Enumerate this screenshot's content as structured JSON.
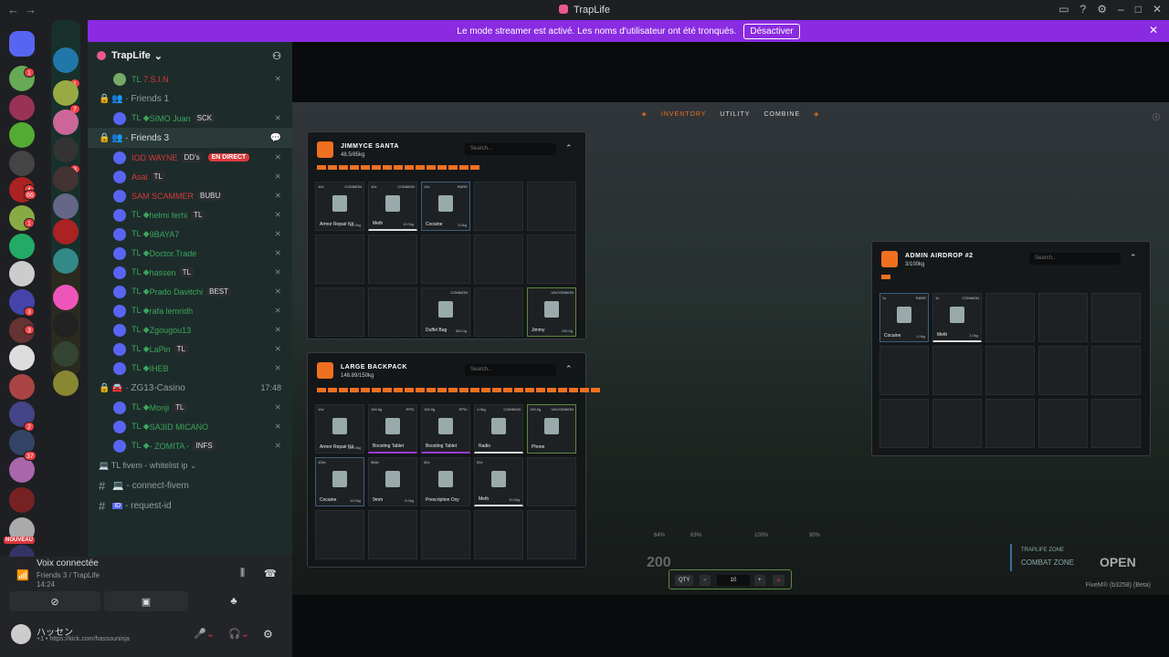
{
  "titlebar": {
    "nav": "←→",
    "title": "TrapLife"
  },
  "banner": {
    "text": "Le mode streamer est activé. Les noms d'utilisateur ont été tronqués.",
    "button": "Désactiver",
    "close": "✕"
  },
  "server_badges": [
    "1",
    "4",
    "66",
    "1",
    "3",
    "3",
    "2",
    "37",
    "1",
    "3",
    "7"
  ],
  "new_label": "NOUVEAU",
  "server": {
    "name": "TrapLife",
    "chevron": "⌄"
  },
  "voice_channels": [
    {
      "name": "Friends 1"
    },
    {
      "name": "Friends 3",
      "active": true
    },
    {
      "name": "ZG13-Casino",
      "time": "17:48"
    }
  ],
  "top_user": {
    "prefix": "TL",
    "name": "7.S.I.N"
  },
  "friends1_users": [
    {
      "prefix": "TL",
      "name": "SIMO Juan",
      "tag": "SCK"
    }
  ],
  "friends3_users": [
    {
      "prefix": "",
      "name": "IOD WAYNE",
      "tag": "DD's",
      "live": "EN DIRECT"
    },
    {
      "prefix": "",
      "name": "Asal",
      "tag": "TL"
    },
    {
      "prefix": "",
      "name": "SAM SCAMMER",
      "tag": "BUBU"
    },
    {
      "prefix": "TL",
      "name": "helmi ferhi",
      "tag": "TL"
    },
    {
      "prefix": "TL",
      "name": "9BAYA7",
      "tag": ""
    },
    {
      "prefix": "TL",
      "name": "Doctor.Trade",
      "tag": ""
    },
    {
      "prefix": "TL",
      "name": "hassen",
      "tag": "TL"
    },
    {
      "prefix": "TL",
      "name": "Prado Davitchi",
      "tag": "BEST"
    },
    {
      "prefix": "TL",
      "name": "rafa lemridh",
      "tag": ""
    },
    {
      "prefix": "TL",
      "name": "Zgougou13",
      "tag": ""
    },
    {
      "prefix": "TL",
      "name": "LaPin",
      "tag": "TL"
    },
    {
      "prefix": "TL",
      "name": "IHEB",
      "tag": ""
    }
  ],
  "casino_users": [
    {
      "prefix": "TL",
      "name": "Monji",
      "tag": "TL"
    },
    {
      "prefix": "TL",
      "name": "SA3ID MICANO",
      "tag": ""
    },
    {
      "prefix": "TL",
      "name": "- ZOMITA -",
      "tag": "INFS"
    }
  ],
  "category": "TL fivem - whitelist ip",
  "text_channels": [
    {
      "name": "connect-fivem"
    },
    {
      "name": "request-id"
    }
  ],
  "voice": {
    "title": "Voix connectée",
    "sub": "Friends 3 / TrapLife",
    "time": "14:24"
  },
  "user": {
    "name": "ハッセン",
    "status": "+1 • https://kick.com/hassouninja"
  },
  "game": {
    "nav": [
      "INVENTORY",
      "UTILITY",
      "COMBINE"
    ],
    "panel1": {
      "title": "JIMMYCE SANTA",
      "weight": "48.5/85kg",
      "search": "Search...",
      "bars": 15,
      "slots": [
        {
          "q": "10x",
          "r": "COMMON",
          "n": "Armor Repair Kit",
          "w": "22.0kg",
          "c": ""
        },
        {
          "q": "10x",
          "r": "COMMON",
          "n": "Meth",
          "w": "10.0kg",
          "c": "white"
        },
        {
          "q": "12x",
          "r": "RARE",
          "n": "Cocaine",
          "w": "3.0kg",
          "c": "blue"
        },
        {},
        {},
        {},
        {},
        {},
        {},
        {},
        {},
        {},
        {
          "q": "",
          "r": "COMMON",
          "n": "Duffel Bag",
          "w": "500.0g",
          "c": ""
        },
        {},
        {
          "q": "",
          "r": "UNCOMMON",
          "n": "Jimmy",
          "w": "190.0g",
          "c": "green"
        }
      ]
    },
    "panel2": {
      "title": "LARGE BACKPACK",
      "weight": "148.89/150kg",
      "search": "Search...",
      "bars": 26,
      "slots": [
        {
          "q": "10x",
          "r": "",
          "n": "Armor Repair Kit",
          "w": "100.0kg",
          "c": ""
        },
        {
          "q": "100.0g",
          "r": "EPIC",
          "n": "Boosting Tablet",
          "w": "",
          "c": "purple"
        },
        {
          "q": "100.0g",
          "r": "EPIC",
          "n": "Boosting Tablet",
          "w": "",
          "c": "purple"
        },
        {
          "q": "1.0kg",
          "r": "COMMON",
          "n": "Radio",
          "w": "",
          "c": "white"
        },
        {
          "q": "190.0g",
          "r": "UNCOMMON",
          "n": "Phone",
          "w": "",
          "c": "green"
        },
        {
          "q": "100x",
          "r": "",
          "n": "Cocaine",
          "w": "10.0kg",
          "c": "blue"
        },
        {
          "q": "568x",
          "r": "",
          "n": "9mm",
          "w": "5.0kg",
          "c": ""
        },
        {
          "q": "40x",
          "r": "",
          "n": "Prescription Oxy",
          "w": "",
          "c": ""
        },
        {
          "q": "50x",
          "r": "",
          "n": "Meth",
          "w": "10.0kg",
          "c": "white"
        },
        {},
        {},
        {},
        {},
        {},
        {}
      ]
    },
    "panel3": {
      "title": "ADMIN AIRDROP #2",
      "weight": "3/100kg",
      "search": "Search...",
      "bars": 1,
      "slots": [
        {
          "q": "1x",
          "r": "RARE",
          "n": "Cocaine",
          "w": "1.0kg",
          "c": "blue"
        },
        {
          "q": "1x",
          "r": "COMMON",
          "n": "Meth",
          "w": "1.0kg",
          "c": "white"
        },
        {},
        {},
        {},
        {},
        {},
        {},
        {},
        {},
        {},
        {},
        {},
        {},
        {}
      ]
    },
    "qty": {
      "label": "QTY",
      "minus": "−",
      "value": "10",
      "plus": "+",
      "close": "✕"
    },
    "hud": [
      "64%",
      "63%",
      "100%",
      "90%"
    ],
    "speed": "200",
    "zone": {
      "label": "TRAPLIFE ZONE",
      "zone": "COMBAT ZONE",
      "state": "OPEN"
    },
    "fivem": "FiveM® (b3258) (Beta)"
  }
}
